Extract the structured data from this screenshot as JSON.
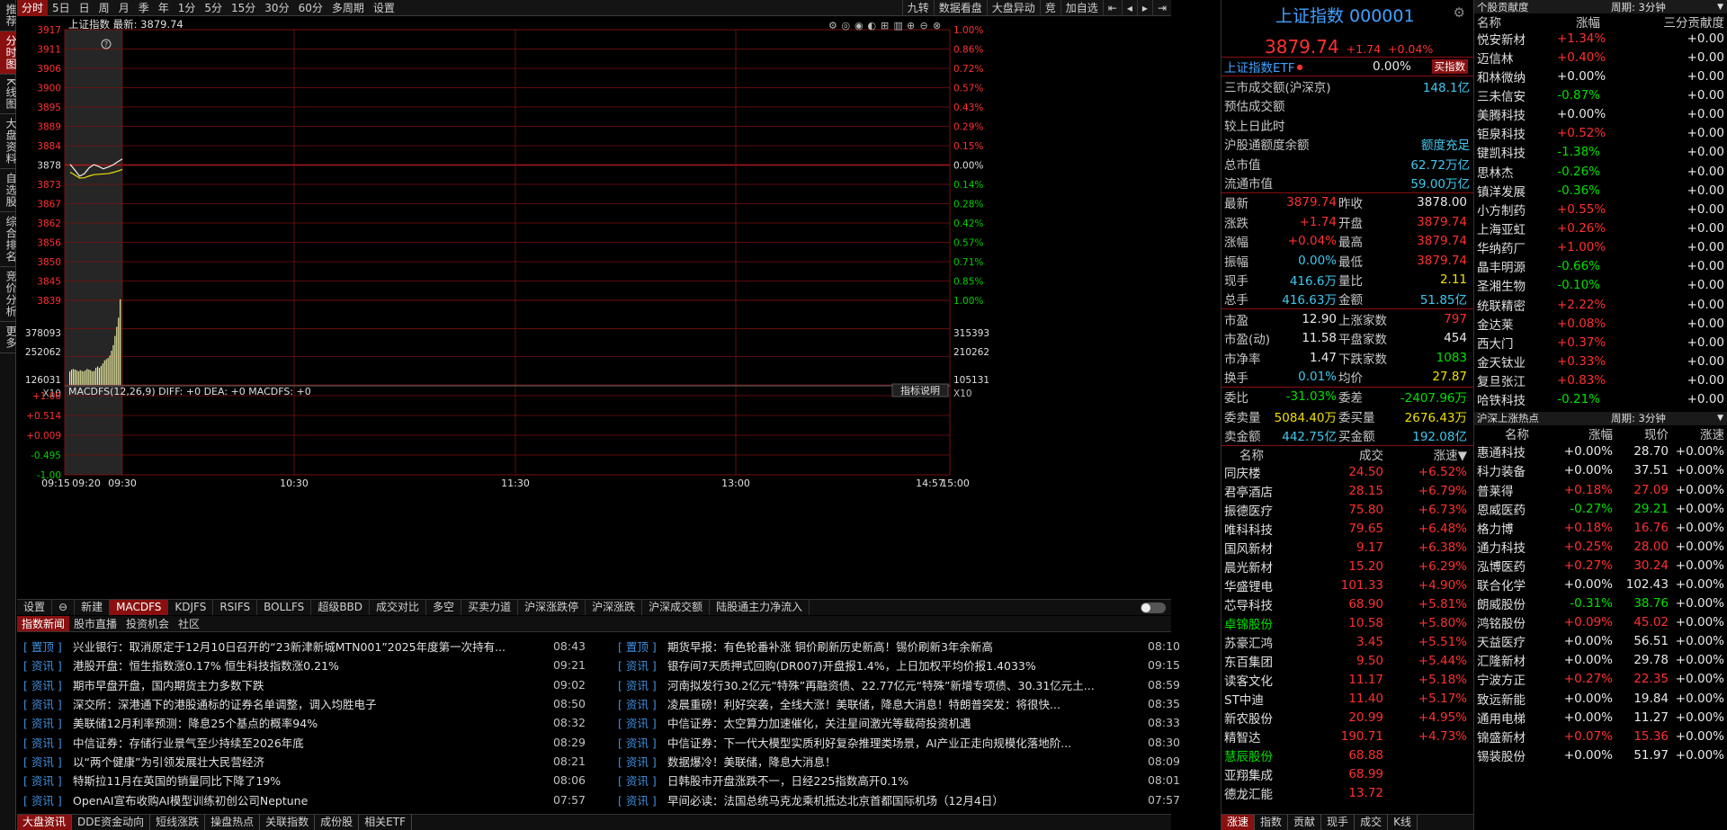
{
  "left_tabs": [
    "推荐",
    "分时图",
    "K线图",
    "大盘资料",
    "自选股",
    "综合排名",
    "竞价分析",
    "更多"
  ],
  "left_tabs_active": 1,
  "toolbar": {
    "items": [
      "分时",
      "5日",
      "日",
      "周",
      "月",
      "季",
      "年",
      "1分",
      "5分",
      "15分",
      "30分",
      "60分",
      "多周期",
      "设置"
    ],
    "active": 0,
    "right": [
      "九转",
      "数据看盘",
      "大盘异动",
      "竞",
      "加自选",
      "⇤",
      "◂",
      "▸",
      "⇥"
    ]
  },
  "chart": {
    "title": "上证指数  最新: 3879.74",
    "base": 3878.0,
    "price_ticks": [
      "3917",
      "3911",
      "3906",
      "3900",
      "3895",
      "3889",
      "3884",
      "3878",
      "3873",
      "3867",
      "3862",
      "3856",
      "3850",
      "3845",
      "3839"
    ],
    "pct_ticks_up": [
      "1.00%",
      "0.86%",
      "0.72%",
      "0.57%",
      "0.43%",
      "0.29%",
      "0.15%",
      "0.00%"
    ],
    "pct_ticks_down": [
      "0.14%",
      "0.28%",
      "0.42%",
      "0.57%",
      "0.71%",
      "0.85%",
      "1.00%"
    ],
    "vol_left": [
      "378093",
      "252062",
      "126031",
      "X10"
    ],
    "vol_right": [
      "315393",
      "210262",
      "105131",
      "X10"
    ],
    "macd_label": "MACDFS(12,26,9) DIFF: +0  DEA: +0  MACDFS: +0",
    "macd_ticks": [
      "+1.00",
      "+0.514",
      "+0.009",
      "-0.495",
      "-1.00"
    ],
    "help_btn": "指标说明",
    "time_ticks": [
      "09:15",
      "09:20",
      "09:30",
      "10:30",
      "11:30",
      "13:00",
      "14:57",
      "15:00"
    ],
    "price_line": [
      3878.2,
      3876.5,
      3874.8,
      3875.5,
      3877.2,
      3878.1,
      3877.6,
      3876.9,
      3877.4,
      3878.0,
      3878.9,
      3879.74
    ],
    "avg_line": [
      3878.0,
      3877.2,
      3876.3,
      3876.4,
      3876.9,
      3877.3,
      3877.4,
      3877.5,
      3877.6,
      3877.9,
      3878.3,
      3878.8
    ],
    "volumes": [
      22,
      25,
      26,
      25,
      24,
      22,
      24,
      23,
      22,
      24,
      26,
      25,
      24,
      22,
      23,
      28,
      30,
      28,
      31,
      35,
      40,
      42,
      44,
      48,
      56,
      65,
      80,
      95,
      110,
      140
    ]
  },
  "indicator_tabs": [
    "设置",
    "⊖",
    "新建",
    "MACDFS",
    "KDJFS",
    "RSIFS",
    "BOLLFS",
    "超级BBD",
    "成交对比",
    "多空",
    "买卖力道",
    "沪深涨跌停",
    "沪深涨跌",
    "沪深成交额",
    "陆股通主力净流入"
  ],
  "indicator_active": 3,
  "news_tabs": [
    "指数新闻",
    "股市直播",
    "投资机会",
    "社区"
  ],
  "news_left": [
    {
      "tag": "置顶",
      "title": "兴业银行：取消原定于12月10日召开的“23新津新城MTN001”2025年度第一次持有...",
      "time": "08:43"
    },
    {
      "tag": "资讯",
      "title": "港股开盘：恒生指数涨0.17% 恒生科技指数涨0.21%",
      "time": "09:21"
    },
    {
      "tag": "资讯",
      "title": "期市早盘开盘，国内期货主力多数下跌",
      "time": "09:02"
    },
    {
      "tag": "资讯",
      "title": "深交所：深港通下的港股通标的证券名单调整，调入均胜电子",
      "time": "08:50"
    },
    {
      "tag": "资讯",
      "title": "美联储12月利率预测：降息25个基点的概率94%",
      "time": "08:32"
    },
    {
      "tag": "资讯",
      "title": "中信证券：存储行业景气至少持续至2026年底",
      "time": "08:29"
    },
    {
      "tag": "资讯",
      "title": "以“两个健康”为引领发展壮大民营经济",
      "time": "08:21"
    },
    {
      "tag": "资讯",
      "title": "特斯拉11月在英国的销量同比下降了19%",
      "time": "08:06"
    },
    {
      "tag": "资讯",
      "title": "OpenAI宣布收购AI模型训练初创公司Neptune",
      "time": "07:57"
    }
  ],
  "news_right": [
    {
      "tag": "置顶",
      "title": "期货早报：有色轮番补涨 铜价刷新历史新高！锡价刷新3年余新高",
      "time": "08:10"
    },
    {
      "tag": "资讯",
      "title": "银存间7天质押式回购(DR007)开盘报1.4%，上日加权平均价报1.4033%",
      "time": "09:15"
    },
    {
      "tag": "资讯",
      "title": "河南拟发行30.2亿元“特殊”再融资债、22.77亿元“特殊”新增专项债、30.31亿元土...",
      "time": "08:59"
    },
    {
      "tag": "资讯",
      "title": "凌晨重磅！利好突袭，全线大涨！美联储，降息大消息！特朗普突发：将很快...",
      "time": "08:35"
    },
    {
      "tag": "资讯",
      "title": "中信证券：太空算力加速催化，关注星间激光等载荷投资机遇",
      "time": "08:33"
    },
    {
      "tag": "资讯",
      "title": "中信证券：下一代大模型实质利好复杂推理类场景，AI产业正走向规模化落地阶...",
      "time": "08:30"
    },
    {
      "tag": "资讯",
      "title": "数据爆冷！美联储，降息大消息！",
      "time": "08:09"
    },
    {
      "tag": "资讯",
      "title": "日韩股市开盘涨跌不一，日经225指数高开0.1%",
      "time": "08:01"
    },
    {
      "tag": "资讯",
      "title": "早间必读：法国总统马克龙乘机抵达北京首都国际机场（12月4日）",
      "time": "07:57"
    }
  ],
  "bottom_tabs": [
    "大盘资讯",
    "DDE资金动向",
    "短线涨跌",
    "操盘热点",
    "关联指数",
    "成份股",
    "相关ETF"
  ],
  "bottom_active": 0,
  "quote": {
    "name": "上证指数 000001",
    "price": "3879.74",
    "change": "+1.74",
    "pct": "+0.04%",
    "etf_name": "上证指数ETF",
    "etf_dot": "●",
    "etf_pct": "0.00%",
    "etf_btn": "买指数",
    "info": [
      {
        "k": "三市成交额(沪深京)",
        "v": "148.1亿",
        "c": "cy"
      },
      {
        "k": "预估成交额",
        "v": "",
        "c": "cy"
      },
      {
        "k": "较上日此时",
        "v": "",
        "c": "cy"
      },
      {
        "k": "沪股通额度余额",
        "v": "额度充足",
        "c": "cy"
      },
      {
        "k": "总市值",
        "v": "62.72万亿",
        "c": "cy"
      },
      {
        "k": "流通市值",
        "v": "59.00万亿",
        "c": "cy"
      }
    ],
    "grid1": [
      [
        "最新",
        "3879.74",
        "red",
        "昨收",
        "3878.00",
        "wht"
      ],
      [
        "涨跌",
        "+1.74",
        "red",
        "开盘",
        "3879.74",
        "red"
      ],
      [
        "涨幅",
        "+0.04%",
        "red",
        "最高",
        "3879.74",
        "red"
      ],
      [
        "振幅",
        "0.00%",
        "cy",
        "最低",
        "3879.74",
        "red"
      ],
      [
        "现手",
        "416.6万",
        "cy",
        "量比",
        "2.11",
        "yel"
      ],
      [
        "总手",
        "416.63万",
        "cy",
        "金额",
        "51.85亿",
        "cy"
      ]
    ],
    "grid2": [
      [
        "市盈",
        "12.90",
        "wht",
        "上涨家数",
        "797",
        "red"
      ],
      [
        "市盈(动)",
        "11.58",
        "wht",
        "平盘家数",
        "454",
        "wht"
      ],
      [
        "市净率",
        "1.47",
        "wht",
        "下跌家数",
        "1083",
        "grn"
      ],
      [
        "换手",
        "0.01%",
        "cy",
        "均价",
        "27.87",
        "yel"
      ]
    ],
    "grid3": [
      [
        "委比",
        "-31.03%",
        "grn",
        "委差",
        "-2407.96万",
        "grn"
      ],
      [
        "委卖量",
        "5084.40万",
        "yel",
        "委买量",
        "2676.43万",
        "yel"
      ],
      [
        "卖金额",
        "442.75亿",
        "cy",
        "买金额",
        "192.08亿",
        "cy"
      ]
    ],
    "list_headers": [
      "名称",
      "成交",
      "涨速▼"
    ],
    "list": [
      [
        "同庆楼",
        "24.50",
        "+6.52%",
        "red"
      ],
      [
        "君亭酒店",
        "28.15",
        "+6.79%",
        "red"
      ],
      [
        "振德医疗",
        "75.80",
        "+6.73%",
        "red"
      ],
      [
        "唯科科技",
        "79.65",
        "+6.48%",
        "red"
      ],
      [
        "国风新材",
        "9.17",
        "+6.38%",
        "red"
      ],
      [
        "晨光新材",
        "15.20",
        "+6.29%",
        "red"
      ],
      [
        "华盛锂电",
        "101.33",
        "+4.90%",
        "red"
      ],
      [
        "芯导科技",
        "68.90",
        "+5.81%",
        "red"
      ],
      [
        "卓锦股份",
        "10.58",
        "+5.80%",
        "red"
      ],
      [
        "苏豪汇鸿",
        "3.45",
        "+5.51%",
        "red"
      ],
      [
        "东百集团",
        "9.50",
        "+5.44%",
        "red"
      ],
      [
        "读客文化",
        "11.17",
        "+5.18%",
        "red"
      ],
      [
        "ST中迪",
        "11.40",
        "+5.17%",
        "red"
      ],
      [
        "新农股份",
        "20.99",
        "+4.95%",
        "red"
      ],
      [
        "精智达",
        "190.71",
        "+4.73%",
        "red"
      ],
      [
        "慧辰股份",
        "68.88",
        "",
        ""
      ],
      [
        "亚翔集成",
        "68.99",
        "",
        ""
      ],
      [
        "德龙汇能",
        "13.72",
        "",
        ""
      ]
    ],
    "list_green_names": [
      "卓锦股份",
      "慧辰股份"
    ],
    "list_tabs": [
      "涨速",
      "指数",
      "贡献",
      "现手",
      "成交",
      "K线"
    ]
  },
  "contrib": {
    "title": "个股贡献度",
    "period": "周期: 3分钟",
    "headers": [
      "名称",
      "涨幅",
      "三分贡献度"
    ],
    "rows": [
      [
        "悦安新材",
        "+1.34%",
        "+0.00"
      ],
      [
        "迈信林",
        "+0.40%",
        "+0.00"
      ],
      [
        "和林微纳",
        "+0.00%",
        "+0.00"
      ],
      [
        "三未信安",
        "-0.87%",
        "+0.00"
      ],
      [
        "美腾科技",
        "+0.00%",
        "+0.00"
      ],
      [
        "钜泉科技",
        "+0.52%",
        "+0.00"
      ],
      [
        "键凯科技",
        "-1.38%",
        "+0.00"
      ],
      [
        "思林杰",
        "-0.26%",
        "+0.00"
      ],
      [
        "镇洋发展",
        "-0.36%",
        "+0.00"
      ],
      [
        "小方制药",
        "+0.55%",
        "+0.00"
      ],
      [
        "上海亚虹",
        "+0.26%",
        "+0.00"
      ],
      [
        "华纳药厂",
        "+1.00%",
        "+0.00"
      ],
      [
        "晶丰明源",
        "-0.66%",
        "+0.00"
      ],
      [
        "圣湘生物",
        "-0.10%",
        "+0.00"
      ],
      [
        "统联精密",
        "+2.22%",
        "+0.00"
      ],
      [
        "金达莱",
        "+0.08%",
        "+0.00"
      ],
      [
        "西大门",
        "+0.37%",
        "+0.00"
      ],
      [
        "金天钛业",
        "+0.33%",
        "+0.00"
      ],
      [
        "复旦张江",
        "+0.83%",
        "+0.00"
      ],
      [
        "哈铁科技",
        "-0.21%",
        "+0.00"
      ]
    ]
  },
  "hot": {
    "title": "沪深上涨热点",
    "period": "周期: 3分钟",
    "headers": [
      "名称",
      "涨幅",
      "现价",
      "涨速"
    ],
    "rows": [
      [
        "惠通科技",
        "+0.00%",
        "28.70",
        "+0.00%"
      ],
      [
        "科力装备",
        "+0.00%",
        "37.51",
        "+0.00%"
      ],
      [
        "普莱得",
        "+0.18%",
        "27.09",
        "+0.00%"
      ],
      [
        "恩威医药",
        "-0.27%",
        "29.21",
        "+0.00%"
      ],
      [
        "格力博",
        "+0.18%",
        "16.76",
        "+0.00%"
      ],
      [
        "通力科技",
        "+0.25%",
        "28.00",
        "+0.00%"
      ],
      [
        "泓博医药",
        "+0.27%",
        "30.24",
        "+0.00%"
      ],
      [
        "联合化学",
        "+0.00%",
        "102.43",
        "+0.00%"
      ],
      [
        "朗威股份",
        "-0.31%",
        "38.76",
        "+0.00%"
      ],
      [
        "鸿铭股份",
        "+0.09%",
        "45.02",
        "+0.00%"
      ],
      [
        "天益医疗",
        "+0.00%",
        "56.51",
        "+0.00%"
      ],
      [
        "汇隆新材",
        "+0.00%",
        "29.78",
        "+0.00%"
      ],
      [
        "宁波方正",
        "+0.27%",
        "22.35",
        "+0.00%"
      ],
      [
        "致远新能",
        "+0.00%",
        "19.84",
        "+0.00%"
      ],
      [
        "通用电梯",
        "+0.00%",
        "11.27",
        "+0.00%"
      ],
      [
        "锦盛新材",
        "+0.07%",
        "15.36",
        "+0.00%"
      ],
      [
        "锡装股份",
        "+0.00%",
        "51.97",
        "+0.00%"
      ]
    ]
  }
}
